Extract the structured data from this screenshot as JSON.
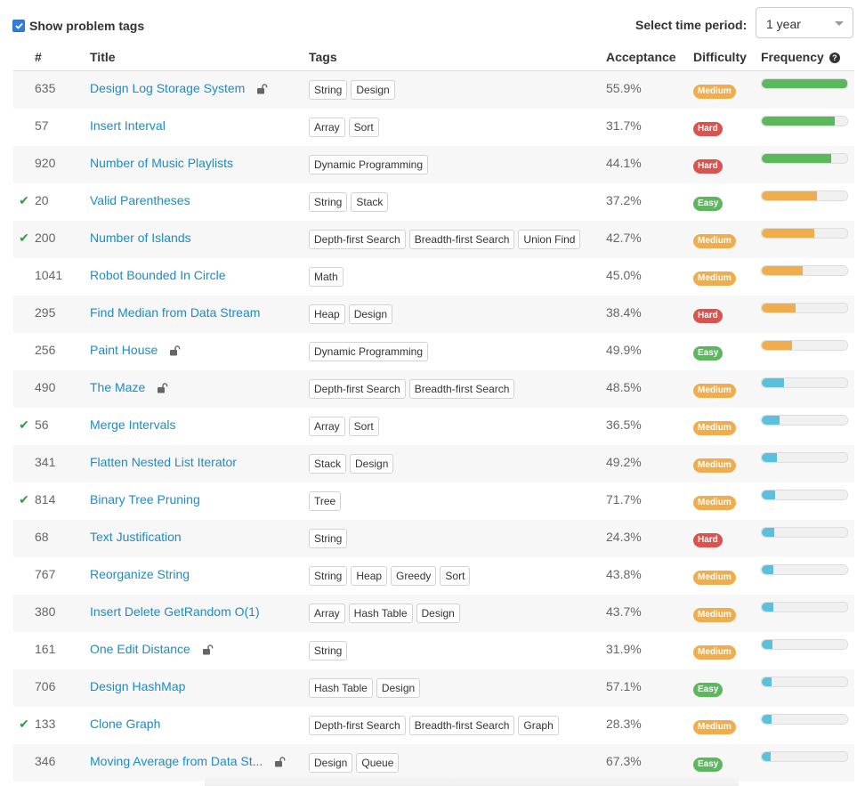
{
  "filters": {
    "show_tags_label": "Show problem tags",
    "show_tags_checked": true,
    "time_period_label": "Select time period:",
    "time_period_value": "1 year"
  },
  "table": {
    "headers": {
      "num": "#",
      "title": "Title",
      "tags": "Tags",
      "acceptance": "Acceptance",
      "difficulty": "Difficulty",
      "frequency": "Frequency"
    },
    "rows": [
      {
        "solved": false,
        "num": "635",
        "title": "Design Log Storage System",
        "locked": true,
        "tags": [
          "String",
          "Design"
        ],
        "acceptance": "55.9%",
        "difficulty": "Medium",
        "frequency": 1.0
      },
      {
        "solved": false,
        "num": "57",
        "title": "Insert Interval",
        "locked": false,
        "tags": [
          "Array",
          "Sort"
        ],
        "acceptance": "31.7%",
        "difficulty": "Hard",
        "frequency": 0.85
      },
      {
        "solved": false,
        "num": "920",
        "title": "Number of Music Playlists",
        "locked": false,
        "tags": [
          "Dynamic Programming"
        ],
        "acceptance": "44.1%",
        "difficulty": "Hard",
        "frequency": 0.81
      },
      {
        "solved": true,
        "num": "20",
        "title": "Valid Parentheses",
        "locked": false,
        "tags": [
          "String",
          "Stack"
        ],
        "acceptance": "37.2%",
        "difficulty": "Easy",
        "frequency": 0.65
      },
      {
        "solved": true,
        "num": "200",
        "title": "Number of Islands",
        "locked": false,
        "tags": [
          "Depth-first Search",
          "Breadth-first Search",
          "Union Find"
        ],
        "acceptance": "42.7%",
        "difficulty": "Medium",
        "frequency": 0.61
      },
      {
        "solved": false,
        "num": "1041",
        "title": "Robot Bounded In Circle",
        "locked": false,
        "tags": [
          "Math"
        ],
        "acceptance": "45.0%",
        "difficulty": "Medium",
        "frequency": 0.48
      },
      {
        "solved": false,
        "num": "295",
        "title": "Find Median from Data Stream",
        "locked": false,
        "tags": [
          "Heap",
          "Design"
        ],
        "acceptance": "38.4%",
        "difficulty": "Hard",
        "frequency": 0.4
      },
      {
        "solved": false,
        "num": "256",
        "title": "Paint House",
        "locked": true,
        "tags": [
          "Dynamic Programming"
        ],
        "acceptance": "49.9%",
        "difficulty": "Easy",
        "frequency": 0.35
      },
      {
        "solved": false,
        "num": "490",
        "title": "The Maze",
        "locked": true,
        "tags": [
          "Depth-first Search",
          "Breadth-first Search"
        ],
        "acceptance": "48.5%",
        "difficulty": "Medium",
        "frequency": 0.26
      },
      {
        "solved": true,
        "num": "56",
        "title": "Merge Intervals",
        "locked": false,
        "tags": [
          "Array",
          "Sort"
        ],
        "acceptance": "36.5%",
        "difficulty": "Medium",
        "frequency": 0.21
      },
      {
        "solved": false,
        "num": "341",
        "title": "Flatten Nested List Iterator",
        "locked": false,
        "tags": [
          "Stack",
          "Design"
        ],
        "acceptance": "49.2%",
        "difficulty": "Medium",
        "frequency": 0.18
      },
      {
        "solved": true,
        "num": "814",
        "title": "Binary Tree Pruning",
        "locked": false,
        "tags": [
          "Tree"
        ],
        "acceptance": "71.7%",
        "difficulty": "Medium",
        "frequency": 0.16
      },
      {
        "solved": false,
        "num": "68",
        "title": "Text Justification",
        "locked": false,
        "tags": [
          "String"
        ],
        "acceptance": "24.3%",
        "difficulty": "Hard",
        "frequency": 0.15
      },
      {
        "solved": false,
        "num": "767",
        "title": "Reorganize String",
        "locked": false,
        "tags": [
          "String",
          "Heap",
          "Greedy",
          "Sort"
        ],
        "acceptance": "43.8%",
        "difficulty": "Medium",
        "frequency": 0.14
      },
      {
        "solved": false,
        "num": "380",
        "title": "Insert Delete GetRandom O(1)",
        "locked": false,
        "tags": [
          "Array",
          "Hash Table",
          "Design"
        ],
        "acceptance": "43.7%",
        "difficulty": "Medium",
        "frequency": 0.14
      },
      {
        "solved": false,
        "num": "161",
        "title": "One Edit Distance",
        "locked": true,
        "tags": [
          "String"
        ],
        "acceptance": "31.9%",
        "difficulty": "Medium",
        "frequency": 0.12
      },
      {
        "solved": false,
        "num": "706",
        "title": "Design HashMap",
        "locked": false,
        "tags": [
          "Hash Table",
          "Design"
        ],
        "acceptance": "57.1%",
        "difficulty": "Easy",
        "frequency": 0.11
      },
      {
        "solved": true,
        "num": "133",
        "title": "Clone Graph",
        "locked": false,
        "tags": [
          "Depth-first Search",
          "Breadth-first Search",
          "Graph"
        ],
        "acceptance": "28.3%",
        "difficulty": "Medium",
        "frequency": 0.11
      },
      {
        "solved": false,
        "num": "346",
        "title": "Moving Average from Data St...",
        "locked": true,
        "tags": [
          "Design",
          "Queue"
        ],
        "acceptance": "67.3%",
        "difficulty": "Easy",
        "frequency": 0.1
      }
    ]
  },
  "colors": {
    "link": "#1a8cc8",
    "check": "#2e9e45",
    "easy": "#5cb85c",
    "medium": "#f0ad4e",
    "hard": "#d9534f",
    "freq_high": "#5cb85c",
    "freq_mid": "#f0ad4e",
    "freq_low": "#5bc0de"
  }
}
